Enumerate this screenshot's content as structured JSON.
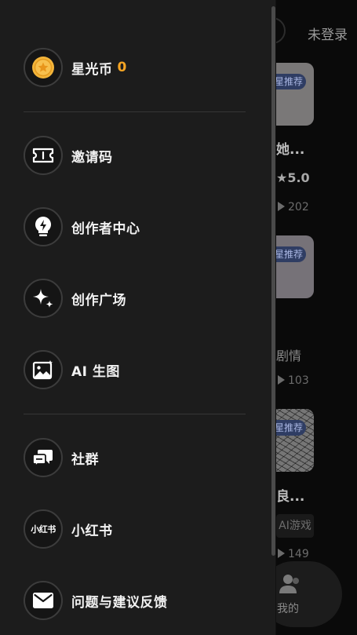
{
  "background": {
    "login_text": "未登录",
    "badges": [
      "星推荐",
      "星推荐",
      "星推荐"
    ],
    "texts": [
      "她...",
      "剧情",
      "良..."
    ],
    "rating": "★5.0",
    "play_counts": [
      "202",
      "103",
      "149"
    ],
    "tag": "AI游戏",
    "tab_label": "我的"
  },
  "drawer": {
    "coin": {
      "label": "星光币",
      "count": "0"
    },
    "items": [
      {
        "label": "邀请码",
        "icon": "ticket-icon"
      },
      {
        "label": "创作者中心",
        "icon": "lightning-bulb-icon"
      },
      {
        "label": "创作广场",
        "icon": "sparkle-icon"
      },
      {
        "label": "AI 生图",
        "icon": "image-sparkle-icon"
      },
      {
        "label": "社群",
        "icon": "chat-bubbles-icon"
      },
      {
        "label": "小红书",
        "icon": "xiaohongshu-icon",
        "icon_text": "小红书"
      },
      {
        "label": "问题与建议反馈",
        "icon": "mail-icon"
      }
    ]
  },
  "colors": {
    "drawer_bg": "#1c1c1c",
    "coin_accent": "#f5a524",
    "badge_bg": "#2f3d63"
  }
}
